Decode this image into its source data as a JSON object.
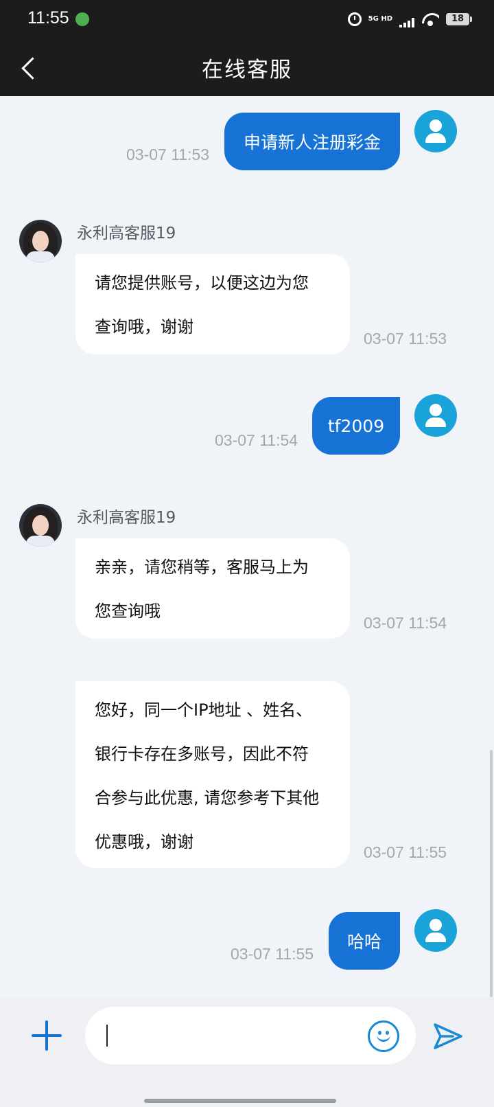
{
  "status_bar": {
    "time": "11:55",
    "network": "5G HD",
    "battery": "18"
  },
  "header": {
    "title": "在线客服"
  },
  "messages": [
    {
      "side": "out",
      "text": "申请新人注册彩金",
      "time": "03-07 11:53"
    },
    {
      "side": "in",
      "agent": "永利高客服19",
      "lines": [
        "请您提供账号，以便这边为您",
        "查询哦，谢谢"
      ],
      "time": "03-07 11:53"
    },
    {
      "side": "out",
      "text": "tf2009",
      "time": "03-07 11:54"
    },
    {
      "side": "in",
      "agent": "永利高客服19",
      "lines": [
        "亲亲，请您稍等，客服马上为",
        "您查询哦"
      ],
      "time": "03-07 11:54"
    },
    {
      "side": "in",
      "lines": [
        "您好，同一个IP地址 、姓名、",
        "银行卡存在多账号，因此不符",
        "合参与此优惠, 请您参考下其他",
        "优惠哦，谢谢"
      ],
      "time": "03-07 11:55"
    },
    {
      "side": "out",
      "text": "哈哈",
      "time": "03-07 11:55"
    }
  ],
  "composer": {
    "value": "",
    "placeholder": ""
  },
  "colors": {
    "accent": "#1672d4",
    "avatar_blue": "#19a3d9",
    "header_bg": "#1c1c1c",
    "chat_bg": "#f0f3f7"
  }
}
